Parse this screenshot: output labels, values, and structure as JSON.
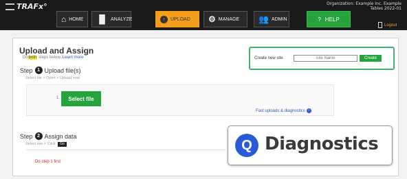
{
  "header": {
    "logo": "TRAFx",
    "org_line1": "Organization: Example Inc. Example",
    "org_line2": "Tables 2022-01",
    "nav": [
      {
        "label": "HOME",
        "icon": "home-icon"
      },
      {
        "label": "ANALYZE",
        "icon": "bar-chart-icon"
      },
      {
        "label": "UPLOAD",
        "icon": "upload-icon",
        "active": true
      },
      {
        "label": "MANAGE",
        "icon": "gears-icon"
      },
      {
        "label": "ADMIN",
        "icon": "users-icon"
      }
    ],
    "help_label": "HELP",
    "help_glyph": "?",
    "logout_label": "Logout"
  },
  "page": {
    "title": "Upload and Assign",
    "subtitle_pre": "Do",
    "subtitle_hl": "both",
    "subtitle_post": " steps below.",
    "learn_more": "Learn more"
  },
  "step1": {
    "label": "Step",
    "number": "1",
    "title": "Upload file(s)",
    "hint": "Select file > Open > Upload now",
    "file_index": "1.",
    "select_button": "Select file",
    "fast_link": "Fast uploads & diagnostics",
    "info_glyph": "i"
  },
  "site": {
    "label": "Create new site",
    "input_placeholder": "Site Name",
    "create_button": "Create"
  },
  "step2": {
    "label": "Step",
    "number": "2",
    "title": "Assign data",
    "hint": "Select site > Click",
    "go_badge": "Go",
    "error": "Do step 1 first"
  },
  "overlay": {
    "title": "Diagnostics",
    "icon_glyph": "Q"
  },
  "colors": {
    "green": "#27a33e",
    "orange": "#f59d1c",
    "blue": "#2a5bd7",
    "error_red": "#c62020"
  }
}
